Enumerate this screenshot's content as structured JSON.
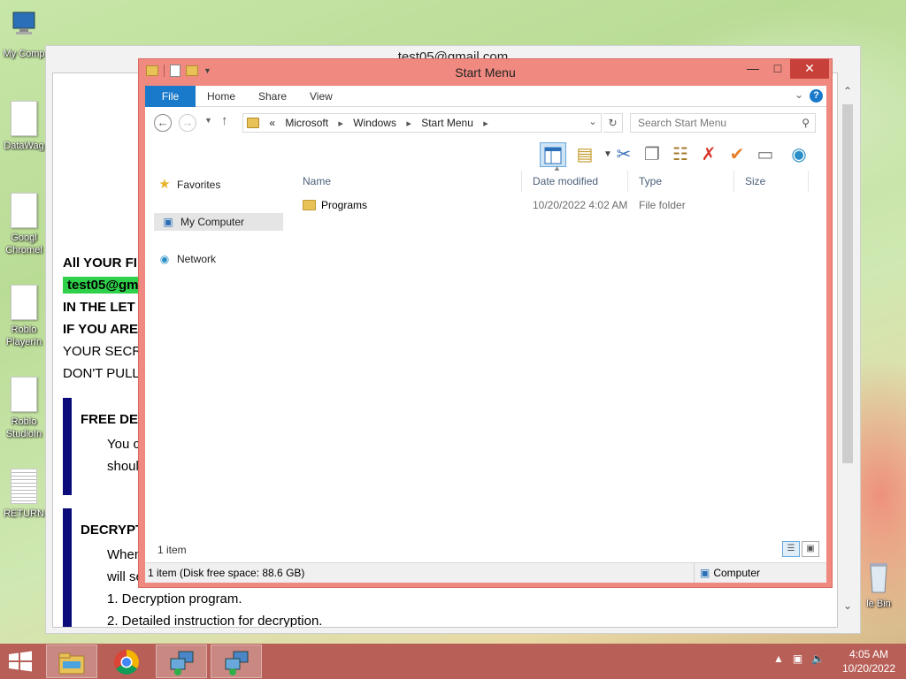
{
  "desktop": {
    "icons": [
      {
        "label": "My Comp",
        "icon": "computer-icon"
      },
      {
        "label": "DataWag",
        "icon": "file-icon"
      },
      {
        "label": "Googl",
        "label2": "Chromel",
        "icon": "file-icon"
      },
      {
        "label": "Roblo",
        "label2": "PlayerIn",
        "icon": "file-icon"
      },
      {
        "label": "Roblo",
        "label2": "StudioIn",
        "icon": "file-icon"
      },
      {
        "label": "RETURN",
        "icon": "text-file-icon"
      },
      {
        "label": "le Bin",
        "icon": "recycle-bin-icon"
      }
    ]
  },
  "ransom_window": {
    "title": "test05@gmail.com",
    "lines": [
      "All YOUR FI",
      "test05@gm",
      "IN THE LET",
      "IF YOU ARE",
      "YOUR SECRE",
      "DON'T PULL"
    ],
    "sections": [
      {
        "heading": "FREE DEC",
        "lines": [
          "You c",
          "shoul"
        ]
      },
      {
        "heading": "DECRYPT",
        "lines": [
          "When",
          "will se",
          "1. Decryption program.",
          "2. Detailed instruction for decryption."
        ]
      }
    ]
  },
  "explorer": {
    "title": "Start Menu",
    "ribbon": {
      "tabs": [
        "File",
        "Home",
        "Share",
        "View"
      ],
      "help": "?"
    },
    "address": {
      "prefix": "«",
      "crumbs": [
        "Microsoft",
        "Windows",
        "Start Menu"
      ]
    },
    "search_placeholder": "Search Start Menu",
    "nav_pane": {
      "items": [
        {
          "label": "Favorites",
          "icon": "star-icon"
        },
        {
          "label": "My Computer",
          "icon": "computer-icon",
          "selected": true
        },
        {
          "label": "Network",
          "icon": "network-icon"
        }
      ]
    },
    "columns": [
      "Name",
      "Date modified",
      "Type",
      "Size"
    ],
    "files": [
      {
        "name": "Programs",
        "date": "10/20/2022 4:02 AM",
        "type": "File folder",
        "size": ""
      }
    ],
    "item_count": "1 item",
    "status_left": "1 item (Disk free space: 88.6 GB)",
    "status_right": "Computer"
  },
  "taskbar": {
    "apps": [
      "file-explorer-icon",
      "chrome-icon",
      "network-setup-icon",
      "network-setup-icon"
    ],
    "clock_time": "4:05 AM",
    "clock_date": "10/20/2022"
  }
}
